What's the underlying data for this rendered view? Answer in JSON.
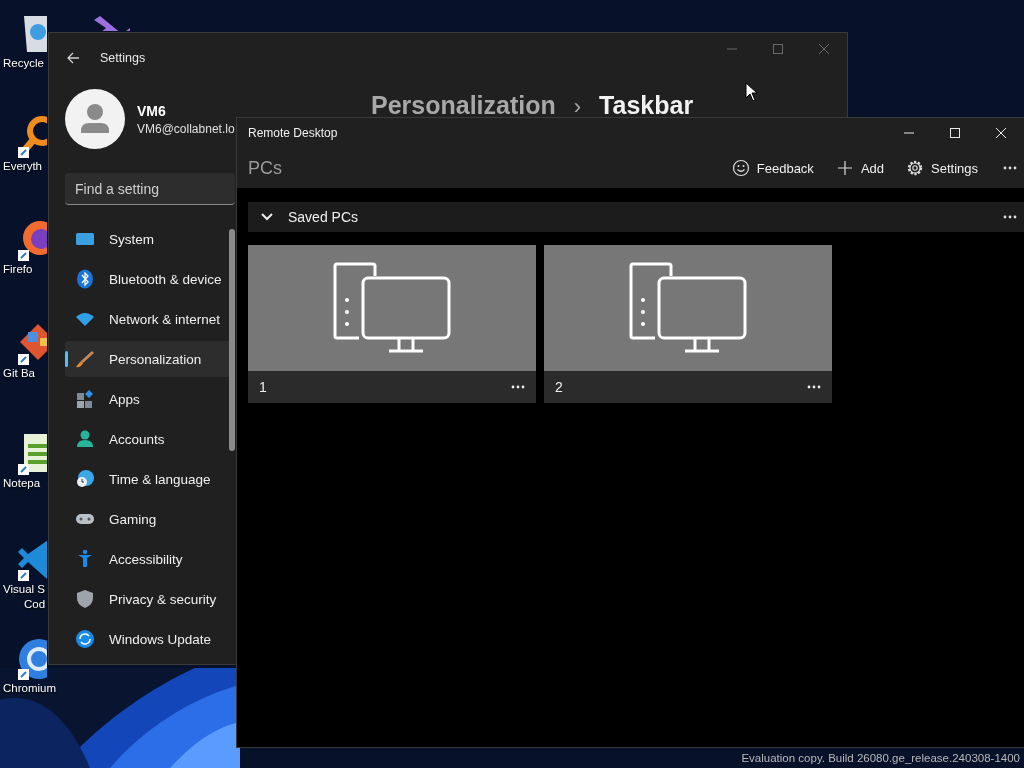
{
  "desktop": {
    "icons": [
      {
        "kind": "recycle",
        "lines": [
          "Recycle"
        ]
      },
      {
        "kind": "studio"
      },
      {
        "kind": "search",
        "lines": [
          "Everyth"
        ]
      },
      {
        "kind": "browser",
        "lines": [
          "Firefo"
        ]
      },
      {
        "kind": "git",
        "lines": [
          "Git Ba"
        ]
      },
      {
        "kind": "notepad",
        "lines": [
          "Notepa"
        ]
      },
      {
        "kind": "code",
        "lines": [
          "Visual S",
          "Cod"
        ]
      },
      {
        "kind": "chromium",
        "lines": [
          "Chromium"
        ]
      }
    ],
    "watermark": "Evaluation copy. Build 26080.ge_release.240308-1400"
  },
  "settings_window": {
    "title": "Settings",
    "user": {
      "name": "VM6",
      "email": "VM6@collabnet.lo"
    },
    "search": {
      "placeholder": "Find a setting"
    },
    "nav": [
      {
        "kind": "system",
        "label": "System",
        "selected": false
      },
      {
        "kind": "bluetooth",
        "label": "Bluetooth & device",
        "selected": false
      },
      {
        "kind": "network",
        "label": "Network & internet",
        "selected": false
      },
      {
        "kind": "personalization",
        "label": "Personalization",
        "selected": true
      },
      {
        "kind": "apps",
        "label": "Apps",
        "selected": false
      },
      {
        "kind": "accounts",
        "label": "Accounts",
        "selected": false
      },
      {
        "kind": "time",
        "label": "Time & language",
        "selected": false
      },
      {
        "kind": "gaming",
        "label": "Gaming",
        "selected": false
      },
      {
        "kind": "accessibility",
        "label": "Accessibility",
        "selected": false
      },
      {
        "kind": "privacy",
        "label": "Privacy & security",
        "selected": false
      },
      {
        "kind": "update",
        "label": "Windows Update",
        "selected": false
      }
    ],
    "breadcrumb": {
      "parent": "Personalization",
      "separator": "›",
      "current": "Taskbar"
    }
  },
  "remote_desktop": {
    "title": "Remote Desktop",
    "heading": "PCs",
    "toolbar": [
      {
        "kind": "feedback",
        "label": "Feedback"
      },
      {
        "kind": "add",
        "label": "Add"
      },
      {
        "kind": "settings",
        "label": "Settings"
      },
      {
        "kind": "more"
      }
    ],
    "group": {
      "label": "Saved PCs",
      "expanded": true
    },
    "pcs": [
      {
        "name": "1"
      },
      {
        "name": "2"
      }
    ]
  }
}
